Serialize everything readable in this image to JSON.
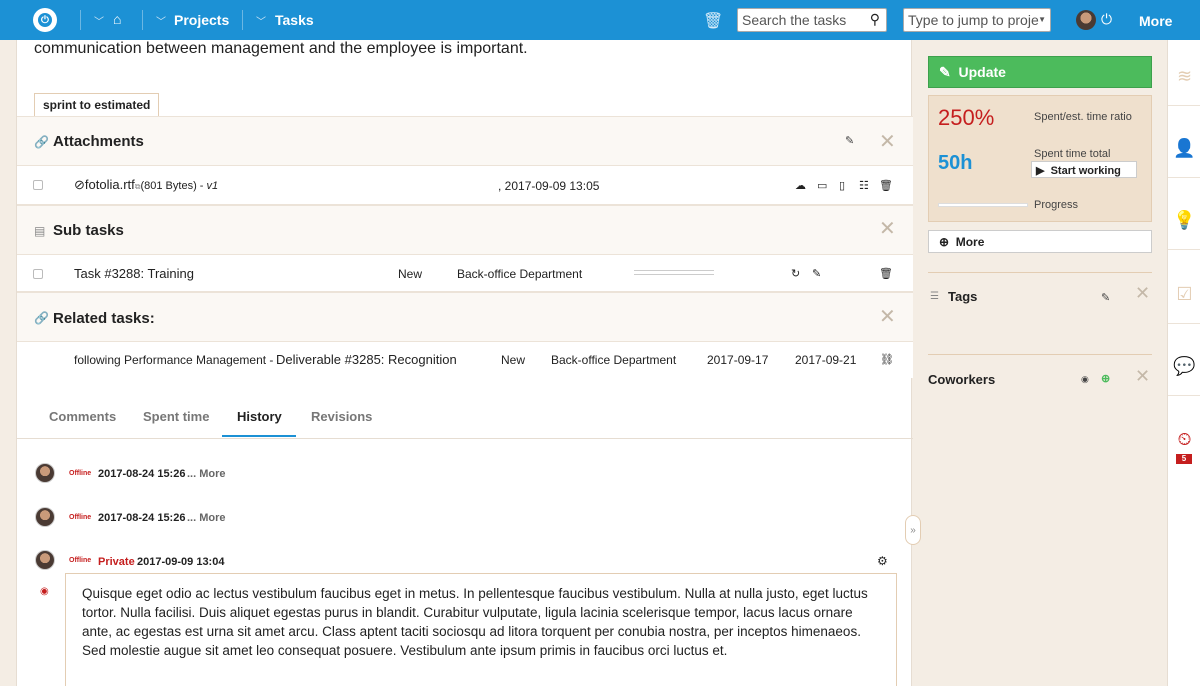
{
  "topbar": {
    "projects_label": "Projects",
    "tasks_label": "Tasks",
    "search_placeholder": "Search the tasks",
    "jump_placeholder": "Type to jump to proje",
    "more_label": "More"
  },
  "task": {
    "description_tail": "communication between management and the employee is important.",
    "tag": "sprint to estimated"
  },
  "attachments": {
    "title": "Attachments",
    "file": {
      "name": "fotolia.rtf",
      "size": "(801 Bytes) - ",
      "version": "v1",
      "date": ", 2017-09-09 13:05"
    }
  },
  "subtasks": {
    "title": "Sub tasks",
    "rows": [
      {
        "name": "Task #3288: Training",
        "status": "New",
        "department": "Back-office Department"
      }
    ]
  },
  "related": {
    "title": "Related tasks:",
    "rows": [
      {
        "relation": "following Performance Management - ",
        "name": "Deliverable #3285: Recognition",
        "status": "New",
        "department": "Back-office Department",
        "start": "2017-09-17",
        "due": "2017-09-21"
      }
    ]
  },
  "tabs": [
    "Comments",
    "Spent time",
    "History",
    "Revisions"
  ],
  "history": [
    {
      "status": "Offline",
      "date": "2017-08-24 15:26",
      "more": "... More"
    },
    {
      "status": "Offline",
      "date": "2017-08-24 15:26",
      "more": "... More"
    },
    {
      "status": "Offline",
      "private": "Private",
      "date": "2017-09-09 13:04"
    }
  ],
  "comment_text": "Quisque eget odio ac lectus vestibulum faucibus eget in metus. In pellentesque faucibus vestibulum. Nulla at nulla justo, eget luctus tortor. Nulla facilisi. Duis aliquet egestas purus in blandit. Curabitur vulputate, ligula lacinia scelerisque tempor, lacus lacus ornare ante, ac egestas est urna sit amet arcu. Class aptent taciti sociosqu ad litora torquent per conubia nostra, per inceptos himenaeos. Sed molestie augue sit amet leo consequat posuere. Vestibulum ante ipsum primis in faucibus orci luctus et.",
  "sidebar": {
    "update_label": "Update",
    "ratio_value": "250%",
    "ratio_label": "Spent/est. time ratio",
    "hours_value": "50h",
    "spent_label": "Spent time total",
    "start_label": "Start working",
    "progress_label": "Progress",
    "progress_fraction": 0,
    "more_label": "More",
    "tags_title": "Tags",
    "coworkers_title": "Coworkers"
  },
  "rail": {
    "badge_count": "5"
  },
  "colors": {
    "brand": "#1c91d5",
    "update_green": "#4cbb5c",
    "alert_red": "#c51e1e"
  }
}
